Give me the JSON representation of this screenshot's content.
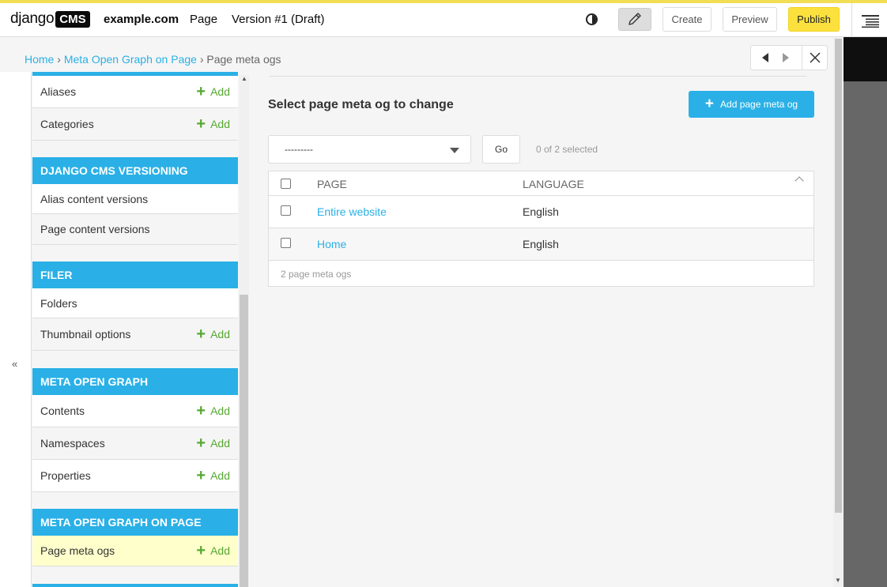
{
  "toolbar": {
    "logo_django": "django",
    "logo_cms": "CMS",
    "site": "example.com",
    "page": "Page",
    "version": "Version #1 (Draft)",
    "create": "Create",
    "preview": "Preview",
    "publish": "Publish"
  },
  "breadcrumb": {
    "home": "Home",
    "sep": "›",
    "app": "Meta Open Graph on Page",
    "current": "Page meta ogs"
  },
  "sidebar": {
    "collapse": "«",
    "add_label": "Add",
    "modules": [
      {
        "title": "",
        "items": [
          {
            "label": "Aliases",
            "add": true
          },
          {
            "label": "Categories",
            "add": true
          }
        ]
      },
      {
        "title": "DJANGO CMS VERSIONING",
        "items": [
          {
            "label": "Alias content versions"
          },
          {
            "label": "Page content versions"
          }
        ]
      },
      {
        "title": "FILER",
        "items": [
          {
            "label": "Folders"
          },
          {
            "label": "Thumbnail options",
            "add": true
          }
        ]
      },
      {
        "title": "META OPEN GRAPH",
        "items": [
          {
            "label": "Contents",
            "add": true
          },
          {
            "label": "Namespaces",
            "add": true
          },
          {
            "label": "Properties",
            "add": true
          }
        ]
      },
      {
        "title": "META OPEN GRAPH ON PAGE",
        "items": [
          {
            "label": "Page meta ogs",
            "add": true,
            "selected": true
          }
        ]
      }
    ]
  },
  "main": {
    "title": "Select page meta og to change",
    "add_button": "Add page meta og",
    "action_select": "---------",
    "go": "Go",
    "selected_count": "0 of 2 selected",
    "columns": [
      "Page",
      "Language"
    ],
    "rows": [
      {
        "page": "Entire website",
        "language": "English"
      },
      {
        "page": "Home",
        "language": "English"
      }
    ],
    "footer": "2 page meta ogs"
  },
  "colors": {
    "accent": "#2ab0e6",
    "publish": "#fce13e",
    "add_green": "#57a832",
    "selected_row": "#ffffcc"
  }
}
